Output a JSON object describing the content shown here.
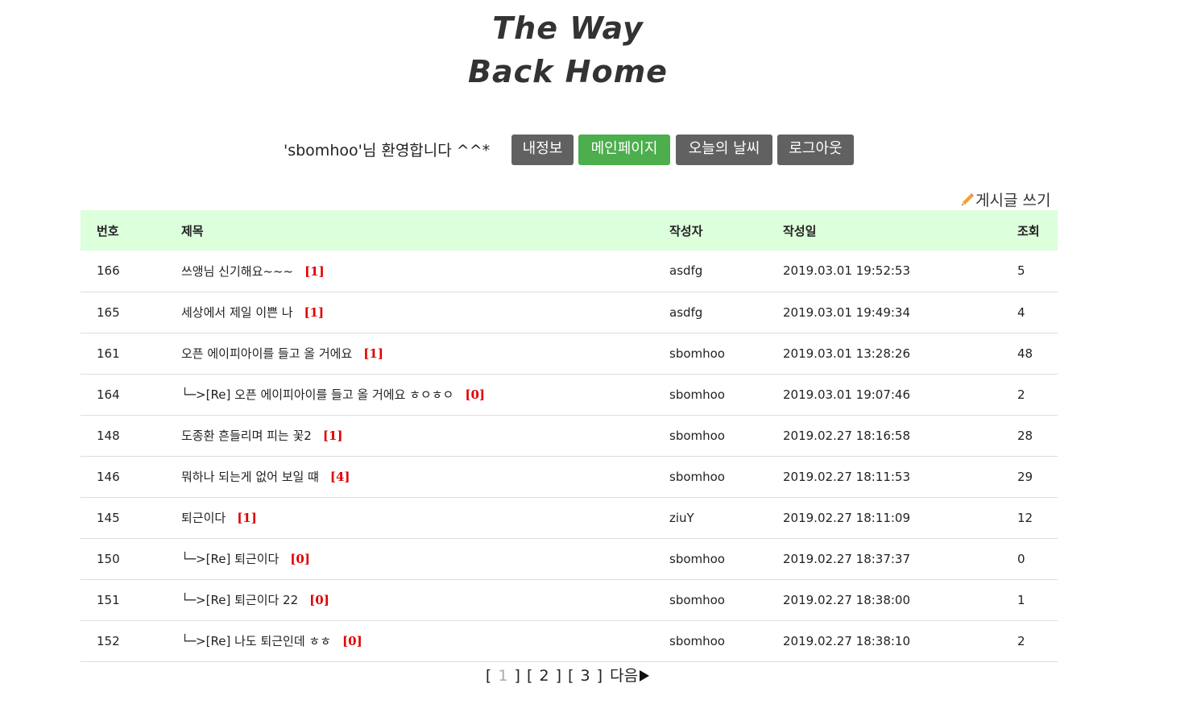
{
  "site": {
    "title_line1": "The Way",
    "title_line2": "Back Home"
  },
  "userbar": {
    "welcome": "'sbomhoo'님 환영합니다 ^^*",
    "buttons": [
      "내정보",
      "메인페이지",
      "오늘의 날씨",
      "로그아웃"
    ],
    "active_color": "#4cae4c",
    "button_color": "#616161"
  },
  "write": {
    "label": "게시글 쓰기",
    "icon": "pencil-icon"
  },
  "table": {
    "header_bg": "#dcffdc",
    "comment_color": "#e00000",
    "columns": [
      "번호",
      "제목",
      "작성자",
      "작성일",
      "조회"
    ],
    "rows": [
      {
        "num": "166",
        "reply": "",
        "title": "쓰앵님 신기해요~~~",
        "comments": "[1]",
        "writer": "asdfg",
        "date": "2019.03.01 19:52:53",
        "views": "5"
      },
      {
        "num": "165",
        "reply": "",
        "title": "세상에서 제일 이쁜 나",
        "comments": "[1]",
        "writer": "asdfg",
        "date": "2019.03.01 19:49:34",
        "views": "4"
      },
      {
        "num": "161",
        "reply": "",
        "title": "오픈 에이피아이를 들고 올 거에요",
        "comments": "[1]",
        "writer": "sbomhoo",
        "date": "2019.03.01 13:28:26",
        "views": "48"
      },
      {
        "num": "164",
        "reply": "└─>",
        "title": "[Re] 오픈 에이피아이를 들고 올 거에요 ㅎㅇㅎㅇ",
        "comments": "[0]",
        "writer": "sbomhoo",
        "date": "2019.03.01 19:07:46",
        "views": "2"
      },
      {
        "num": "148",
        "reply": "",
        "title": "도종환 흔들리며 피는 꽃2",
        "comments": "[1]",
        "writer": "sbomhoo",
        "date": "2019.02.27 18:16:58",
        "views": "28"
      },
      {
        "num": "146",
        "reply": "",
        "title": "뭐하나 되는게 없어 보일 떄",
        "comments": "[4]",
        "writer": "sbomhoo",
        "date": "2019.02.27 18:11:53",
        "views": "29"
      },
      {
        "num": "145",
        "reply": "",
        "title": "퇴근이다",
        "comments": "[1]",
        "writer": "ziuY",
        "date": "2019.02.27 18:11:09",
        "views": "12"
      },
      {
        "num": "150",
        "reply": "└─>",
        "title": "[Re] 퇴근이다",
        "comments": "[0]",
        "writer": "sbomhoo",
        "date": "2019.02.27 18:37:37",
        "views": "0"
      },
      {
        "num": "151",
        "reply": "└─>",
        "title": "[Re] 퇴근이다 22",
        "comments": "[0]",
        "writer": "sbomhoo",
        "date": "2019.02.27 18:38:00",
        "views": "1"
      },
      {
        "num": "152",
        "reply": "└─>",
        "title": "[Re] 나도 퇴근인데 ㅎㅎ",
        "comments": "[0]",
        "writer": "sbomhoo",
        "date": "2019.02.27 18:38:10",
        "views": "2"
      }
    ]
  },
  "pagination": {
    "pages": [
      "1",
      "2",
      "3"
    ],
    "current": "1",
    "next_label": "다음",
    "next_icon": "triangle-right-icon"
  }
}
